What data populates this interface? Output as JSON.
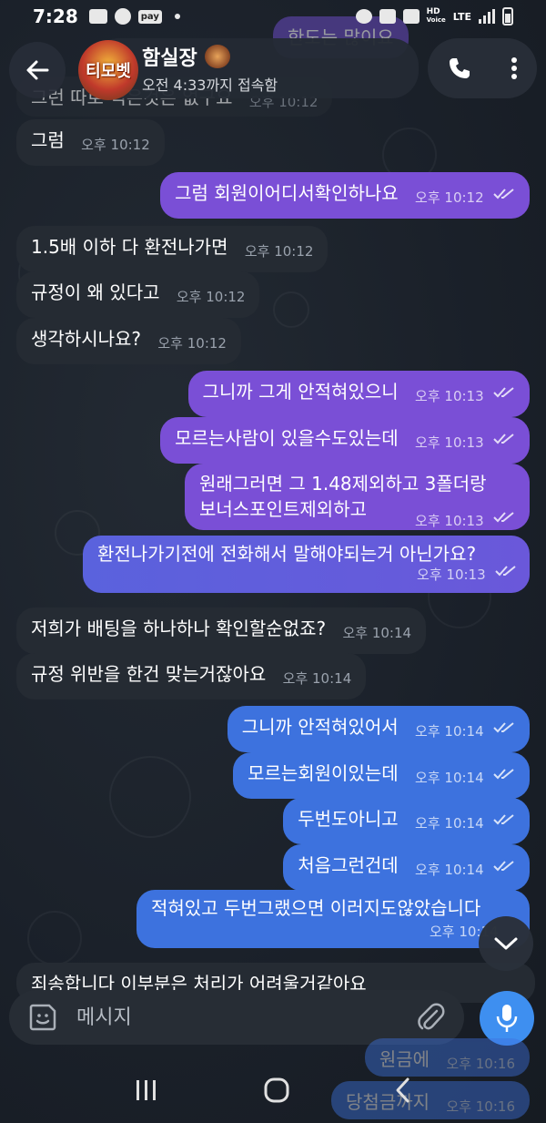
{
  "status_bar": {
    "time": "7:28",
    "pay_label": "pay",
    "hd_label": "HD",
    "voice_label": "Voice",
    "lte_label": "LTE"
  },
  "header": {
    "title": "함실장",
    "status": "오전 4:33까지 접속함",
    "avatar_text": "티모벳"
  },
  "top_partial": {
    "incoming_text": "그런 따로 적은것은 없구요",
    "incoming_time": "오후 10:12",
    "outgoing_text": "한도는 많이요"
  },
  "messages": [
    {
      "side": "in",
      "text": "그럼",
      "time": "오후 10:12"
    },
    {
      "side": "out",
      "text": "그럼 회원이어디서확인하나요",
      "time": "오후 10:12"
    },
    {
      "side": "in",
      "text": "1.5배 이하 다 환전나가면",
      "time": "오후 10:12"
    },
    {
      "side": "in",
      "text": "규정이 왜 있다고",
      "time": "오후 10:12"
    },
    {
      "side": "in",
      "text": "생각하시나요?",
      "time": "오후 10:12"
    },
    {
      "side": "out",
      "text": "그니까 그게 안적혀있으니",
      "time": "오후 10:13"
    },
    {
      "side": "out",
      "text": "모르는사람이 있을수도있는데",
      "time": "오후 10:13"
    },
    {
      "side": "out",
      "text_line1": "원래그러면 그 1.48제외하고 3폴더랑",
      "text_line2": "보너스포인트제외하고",
      "time": "오후 10:13"
    },
    {
      "side": "out",
      "text": "환전나가기전에 전화해서 말해야되는거 아닌가요?",
      "time": "오후 10:13"
    },
    {
      "side": "in",
      "text": "저희가 배팅을 하나하나 확인할순없죠?",
      "time": "오후 10:14"
    },
    {
      "side": "in",
      "text": "규정 위반을 한건 맞는거잖아요",
      "time": "오후 10:14"
    },
    {
      "side": "out",
      "text": "그니까 안적혀있어서",
      "time": "오후 10:14"
    },
    {
      "side": "out",
      "text": "모르는회원이있는데",
      "time": "오후 10:14"
    },
    {
      "side": "out",
      "text": "두번도아니고",
      "time": "오후 10:14"
    },
    {
      "side": "out",
      "text": "처음그런건데",
      "time": "오후 10:14"
    },
    {
      "side": "out",
      "text": "적혀있고 두번그랬으면 이러지도않았습니다",
      "time": "오후 10:14"
    },
    {
      "side": "in",
      "text": "죄송합니다 이부분은 처리가 어려울거같아요",
      "time": ""
    }
  ],
  "bottom_partial": [
    {
      "text": "원금에",
      "time": "오후 10:16"
    },
    {
      "text": "당첨금까지",
      "time": "오후 10:16"
    }
  ],
  "composer": {
    "placeholder": "메시지"
  },
  "colors": {
    "incoming_bubble": "#252b33",
    "outgoing_purple": "#7a4fd6",
    "outgoing_blue": "#3d72de",
    "mic_blue": "#3e8ff0",
    "background": "#1a2029"
  },
  "icons": {
    "back": "arrow-left-icon",
    "call": "phone-icon",
    "menu": "more-vertical-icon",
    "emoji": "sticker-icon",
    "attach": "paperclip-icon",
    "mic": "microphone-icon",
    "scroll": "chevron-down-icon",
    "read": "double-check-icon"
  }
}
